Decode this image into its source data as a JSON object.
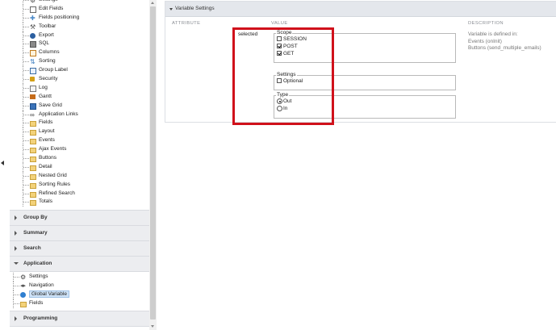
{
  "sidebar": {
    "tree_top": [
      {
        "label": "Settings",
        "icon": "gear-icon"
      },
      {
        "label": "Edit Fields",
        "icon": "edit-icon"
      },
      {
        "label": "Fields positioning",
        "icon": "move-icon"
      },
      {
        "label": "Toolbar",
        "icon": "wrench-icon"
      },
      {
        "label": "Export",
        "icon": "export-icon"
      },
      {
        "label": "SQL",
        "icon": "sql-icon"
      },
      {
        "label": "Columns",
        "icon": "columns-icon"
      },
      {
        "label": "Sorting",
        "icon": "sort-icon"
      },
      {
        "label": "Group Label",
        "icon": "table-icon"
      },
      {
        "label": "Security",
        "icon": "lock-icon"
      },
      {
        "label": "Log",
        "icon": "log-icon"
      },
      {
        "label": "Gantt",
        "icon": "gantt-icon"
      },
      {
        "label": "Save Grid",
        "icon": "save-icon"
      },
      {
        "label": "Application Links",
        "icon": "link-icon"
      },
      {
        "label": "Fields",
        "icon": "folder-icon"
      },
      {
        "label": "Layout",
        "icon": "folder-icon"
      },
      {
        "label": "Events",
        "icon": "folder-icon"
      },
      {
        "label": "Ajax Events",
        "icon": "folder-icon"
      },
      {
        "label": "Buttons",
        "icon": "folder-icon"
      },
      {
        "label": "Detail",
        "icon": "folder-icon"
      },
      {
        "label": "Nested Grid",
        "icon": "folder-icon"
      },
      {
        "label": "Sorting Rules",
        "icon": "folder-icon"
      },
      {
        "label": "Refined Search",
        "icon": "folder-icon"
      },
      {
        "label": "Totals",
        "icon": "folder-icon"
      }
    ],
    "sections": {
      "group_by": "Group By",
      "summary": "Summary",
      "search": "Search",
      "application": "Application",
      "programming": "Programming"
    },
    "application_items": [
      {
        "label": "Settings",
        "icon": "gear-icon"
      },
      {
        "label": "Navigation",
        "icon": "navigation-icon"
      },
      {
        "label": "Global Variable",
        "icon": "globe-icon",
        "selected": true
      },
      {
        "label": "Fields",
        "icon": "folder-icon"
      }
    ]
  },
  "panel": {
    "title": "Variable Settings",
    "columns": {
      "attribute": "ATTRIBUTE",
      "value": "VALUE",
      "description": "DESCRIPTION"
    },
    "variable_name": "selected",
    "scope": {
      "legend": "Scope",
      "options": [
        {
          "label": "SESSION",
          "checked": false
        },
        {
          "label": "POST",
          "checked": true
        },
        {
          "label": "GET",
          "checked": true
        }
      ]
    },
    "settings": {
      "legend": "Settings",
      "options": [
        {
          "label": "Optional",
          "checked": false
        }
      ]
    },
    "type": {
      "legend": "Type",
      "options": [
        {
          "label": "Out",
          "checked": true
        },
        {
          "label": "In",
          "checked": false
        }
      ]
    },
    "description_lines": [
      "Variable is defined in:",
      "Events (onInit)",
      "Buttons (send_multiple_emails)"
    ]
  },
  "colors": {
    "highlight": "#d0111b",
    "section_bg": "#ecedf0",
    "selected_bg": "#cfe3f7"
  }
}
